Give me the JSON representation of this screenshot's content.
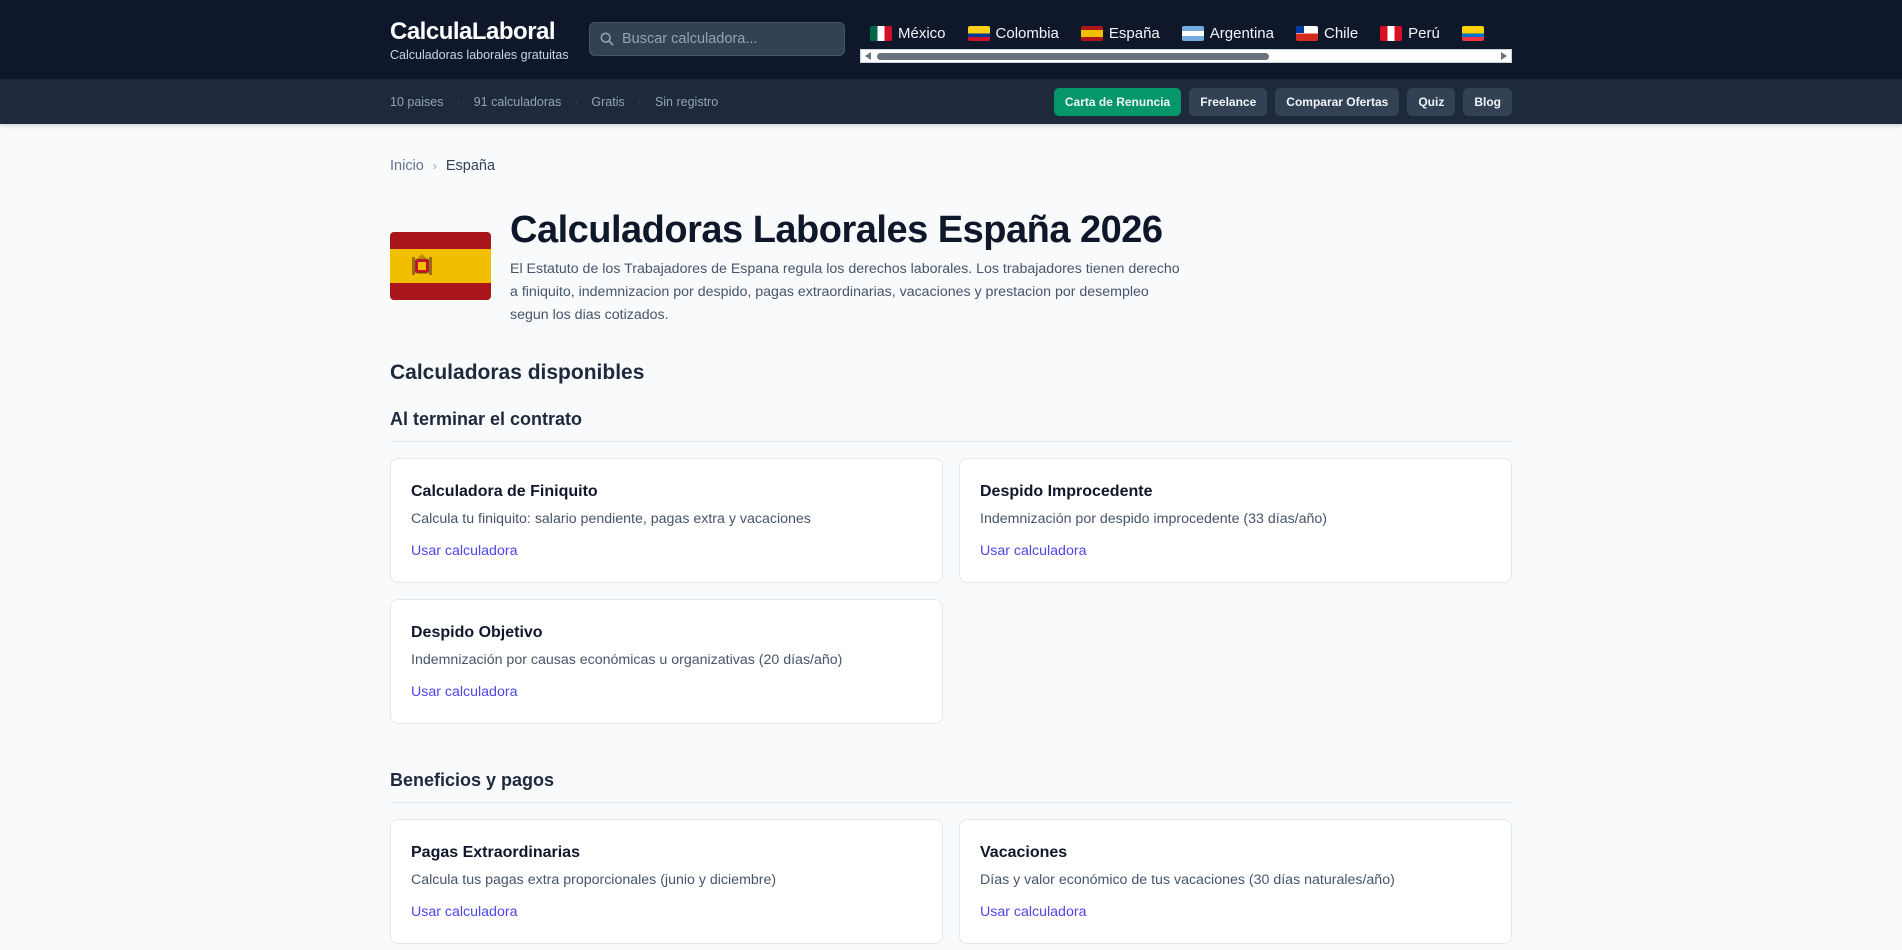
{
  "header": {
    "brand": "CalculaLaboral",
    "tagline": "Calculadoras laborales gratuitas",
    "search_placeholder": "Buscar calculadora...",
    "countries": [
      {
        "name": "México",
        "flag": "mexico-flag"
      },
      {
        "name": "Colombia",
        "flag": "colombia-flag"
      },
      {
        "name": "España",
        "flag": "spain-flag"
      },
      {
        "name": "Argentina",
        "flag": "argentina-flag"
      },
      {
        "name": "Chile",
        "flag": "chile-flag"
      },
      {
        "name": "Perú",
        "flag": "peru-flag"
      },
      {
        "name": "",
        "flag": "ecuador-flag"
      }
    ]
  },
  "subbar": {
    "stats": [
      "10 paises",
      "91 calculadoras",
      "Gratis",
      "Sin registro"
    ],
    "links": [
      "Carta de Renuncia",
      "Freelance",
      "Comparar Ofertas",
      "Quiz",
      "Blog"
    ]
  },
  "breadcrumb": {
    "home": "Inicio",
    "current": "España"
  },
  "hero": {
    "title": "Calculadoras Laborales España 2026",
    "description": "El Estatuto de los Trabajadores de Espana regula los derechos laborales. Los trabajadores tienen derecho a finiquito, indemnizacion por despido, pagas extraordinarias, vacaciones y prestacion por desempleo segun los dias cotizados."
  },
  "section_title": "Calculadoras disponibles",
  "groups": [
    {
      "title": "Al terminar el contrato",
      "cards": [
        {
          "title": "Calculadora de Finiquito",
          "desc": "Calcula tu finiquito: salario pendiente, pagas extra y vacaciones",
          "link": "Usar calculadora"
        },
        {
          "title": "Despido Improcedente",
          "desc": "Indemnización por despido improcedente (33 días/año)",
          "link": "Usar calculadora"
        },
        {
          "title": "Despido Objetivo",
          "desc": "Indemnización por causas económicas u organizativas (20 días/año)",
          "link": "Usar calculadora"
        }
      ]
    },
    {
      "title": "Beneficios y pagos",
      "cards": [
        {
          "title": "Pagas Extraordinarias",
          "desc": "Calcula tus pagas extra proporcionales (junio y diciembre)",
          "link": "Usar calculadora"
        },
        {
          "title": "Vacaciones",
          "desc": "Días y valor económico de tus vacaciones (30 días naturales/año)",
          "link": "Usar calculadora"
        }
      ]
    }
  ],
  "colors": {
    "header_bg": "#0f172a",
    "subbar_bg": "#1e293b",
    "primary_button": "#059669",
    "link": "#4f46e5",
    "page_bg": "#f8fafc"
  }
}
